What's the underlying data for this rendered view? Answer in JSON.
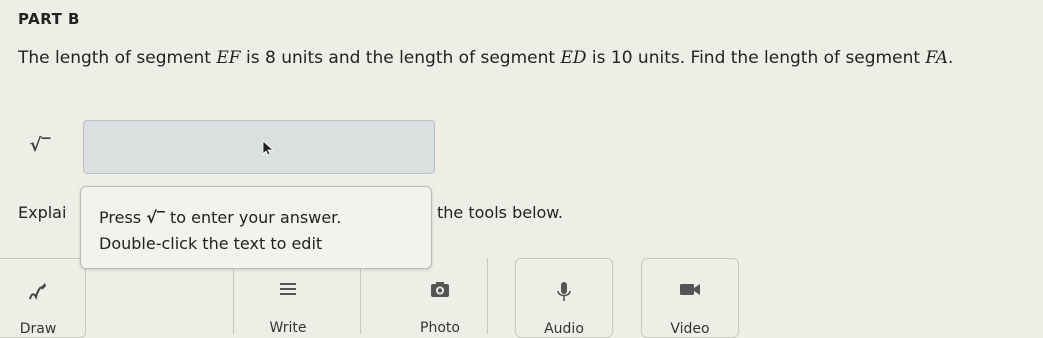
{
  "part_label": "PART B",
  "question": {
    "t1": "The length of segment ",
    "seg1": "EF",
    "t2": " is 8 units and the length of segment ",
    "seg2": "ED",
    "t3": " is 10 units. Find the length of segment ",
    "seg3": "FA",
    "t4": "."
  },
  "sqrt_button_glyph": "√‾",
  "answer_value": "",
  "explain": {
    "label_start": "Explai",
    "label_end": "the tools below."
  },
  "tooltip": {
    "press": "Press",
    "sqrt_glyph": "√‾",
    "rest": "to enter your answer.",
    "line2": "Double-click the text to edit"
  },
  "tools": [
    {
      "label": "Draw",
      "icon": "draw-icon"
    },
    {
      "label": "Write",
      "icon": "lines-icon"
    },
    {
      "label": "Photo",
      "icon": "camera-icon"
    },
    {
      "label": "Audio",
      "icon": "microphone-icon"
    },
    {
      "label": "Video",
      "icon": "video-icon"
    }
  ]
}
